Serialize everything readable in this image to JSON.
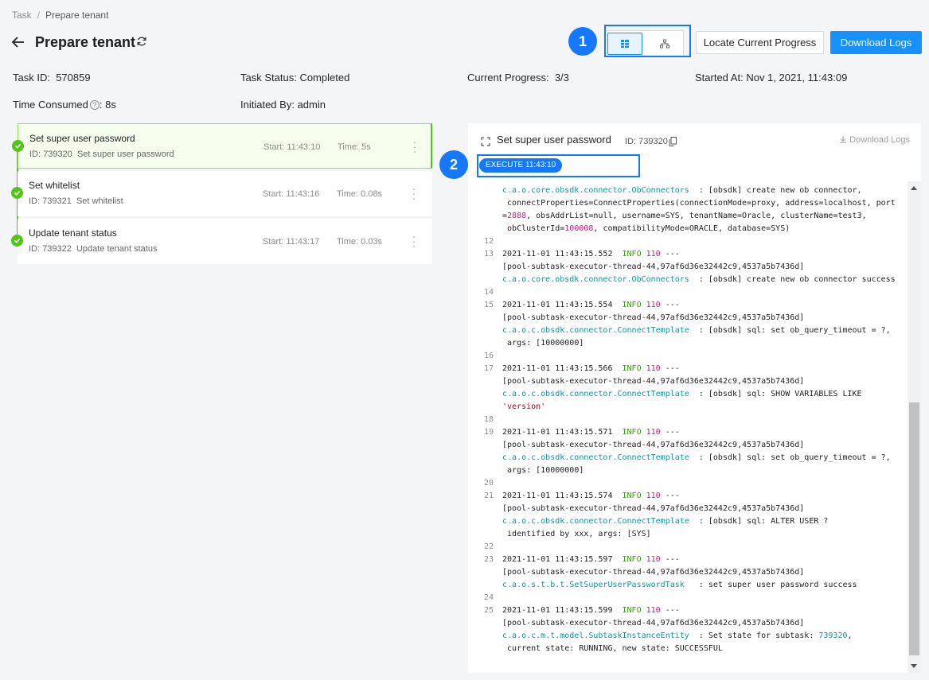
{
  "breadcrumb": {
    "parent": "Task",
    "separator": "/",
    "current": "Prepare tenant"
  },
  "page": {
    "title": "Prepare tenant"
  },
  "toolbar": {
    "badge_1": "1",
    "locate_label": "Locate Current Progress",
    "download_label": "Download Logs"
  },
  "meta": {
    "task_id_label": "Task ID:",
    "task_id_value": "570859",
    "status_label": "Task Status:",
    "status_value": "Completed",
    "progress_label": "Current Progress:",
    "progress_value": "3/3",
    "started_label": "Started At:",
    "started_value": "Nov 1, 2021, 11:43:09",
    "consumed_label": "Time Consumed",
    "consumed_value": "8s",
    "initiated_label": "Initiated By:",
    "initiated_value": "admin"
  },
  "steps": [
    {
      "name": "Set super user password",
      "id": "ID: 739320",
      "desc": "Set super user password",
      "start": "Start: 11:43:10",
      "time": "Time: 5s"
    },
    {
      "name": "Set whitelist",
      "id": "ID: 739321",
      "desc": "Set whitelist",
      "start": "Start: 11:43:16",
      "time": "Time: 0.08s"
    },
    {
      "name": "Update tenant status",
      "id": "ID: 739322",
      "desc": "Update tenant status",
      "start": "Start: 11:43:17",
      "time": "Time: 0.03s"
    }
  ],
  "log_panel": {
    "title": "Set super user password",
    "id": "ID: 739320",
    "download_label": "Download Logs",
    "exec_tag": "EXECUTE 11:43:10",
    "badge_2": "2"
  },
  "colors": {
    "primary": "#1890ff",
    "success": "#52c41a",
    "highlight": "#1677ff"
  },
  "icons": [
    "back-arrow-icon",
    "refresh-icon",
    "list-view-icon",
    "tree-view-icon",
    "check-icon",
    "more-icon",
    "expand-icon",
    "copy-icon",
    "download-icon",
    "help-icon"
  ]
}
